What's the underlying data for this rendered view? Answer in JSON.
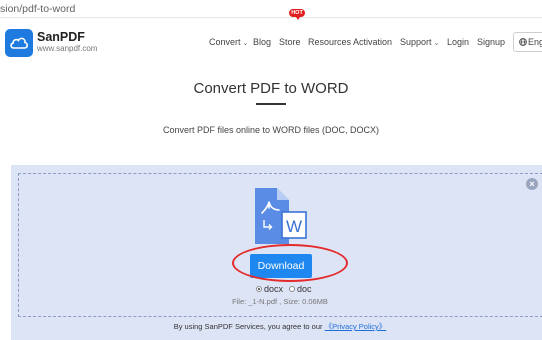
{
  "browser": {
    "url_fragment": "sion/pdf-to-word"
  },
  "brand": {
    "name": "SanPDF",
    "url": "www.sanpdf.com",
    "accent": "#1f7ae0"
  },
  "nav": {
    "items": [
      {
        "label": "Convert",
        "has_caret": true
      },
      {
        "label": "Blog"
      },
      {
        "label": "Store",
        "badge": "HOT"
      },
      {
        "label": "Resources"
      },
      {
        "label": "Activation"
      },
      {
        "label": "Support",
        "has_caret": true
      },
      {
        "label": "Login"
      },
      {
        "label": "Signup"
      }
    ],
    "language": "Engl",
    "caret": "⌄"
  },
  "main": {
    "title": "Convert PDF to WORD",
    "subtitle": "Convert PDF files online to WORD files (DOC, DOCX)"
  },
  "upload": {
    "close_glyph": "×",
    "file_icon": "pdf-to-word-file-icon",
    "file_icon_letter": "W",
    "download_label": "Download",
    "formats": [
      {
        "label": "docx",
        "checked": true
      },
      {
        "label": "doc",
        "checked": false
      }
    ],
    "file_info": "File: _1-N.pdf , Size: 0.06MB",
    "terms_prefix": "By using SanPDF Services, you agree to our",
    "terms_link": "《Privacy Policy》",
    "panel_color": "#dde4f5",
    "button_color": "#1e87f0",
    "highlight_color": "#e32b2b"
  }
}
